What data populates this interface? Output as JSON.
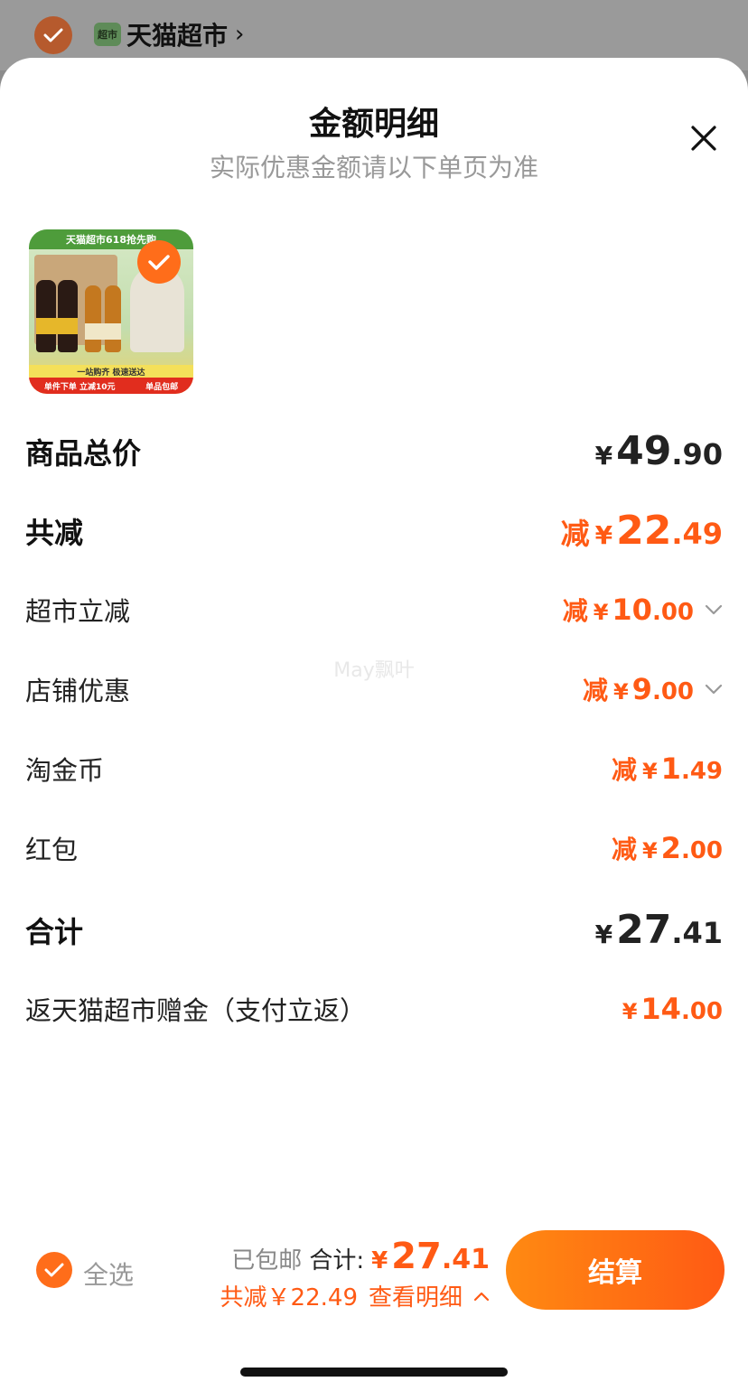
{
  "top": {
    "store_badge": "超市",
    "store_name": "天猫超市",
    "chevron": "›"
  },
  "sheet": {
    "title": "金额明细",
    "subtitle": "实际优惠金额请以下单页为准"
  },
  "product": {
    "banner": "天猫超市618抢先购",
    "strip": "一站购齐 极速送达",
    "promo_left": "单件下单 立减10元",
    "promo_right": "单品包邮"
  },
  "rows": {
    "total_price": {
      "label": "商品总价",
      "yen": "¥",
      "int": "49",
      "dec": ".90"
    },
    "total_discount": {
      "label": "共减",
      "prefix": "减",
      "yen": "¥",
      "int": "22",
      "dec": ".49"
    },
    "supermarket": {
      "label": "超市立减",
      "prefix": "减",
      "yen": "¥",
      "int": "10",
      "dec": ".00"
    },
    "store": {
      "label": "店铺优惠",
      "prefix": "减",
      "yen": "¥",
      "int": "9",
      "dec": ".00"
    },
    "taojinbi": {
      "label": "淘金币",
      "prefix": "减",
      "yen": "¥",
      "int": "1",
      "dec": ".49"
    },
    "hongbao": {
      "label": "红包",
      "prefix": "减",
      "yen": "¥",
      "int": "2",
      "dec": ".00"
    },
    "subtotal": {
      "label": "合计",
      "yen": "¥",
      "int": "27",
      "dec": ".41"
    },
    "rebate": {
      "label": "返天猫超市赠金（支付立返）",
      "yen": "¥",
      "int": "14",
      "dec": ".00"
    }
  },
  "watermark": "May飘叶",
  "footer": {
    "select_all": "全选",
    "shipped": "已包邮",
    "total_label": "合计:",
    "total_yen": "¥",
    "total_int": "27",
    "total_dec": ".41",
    "discount_text": "共减￥22.49",
    "details_link": "查看明细",
    "checkout": "结算"
  },
  "colors": {
    "accent": "#ff5a14",
    "check": "#ff6d1a"
  }
}
